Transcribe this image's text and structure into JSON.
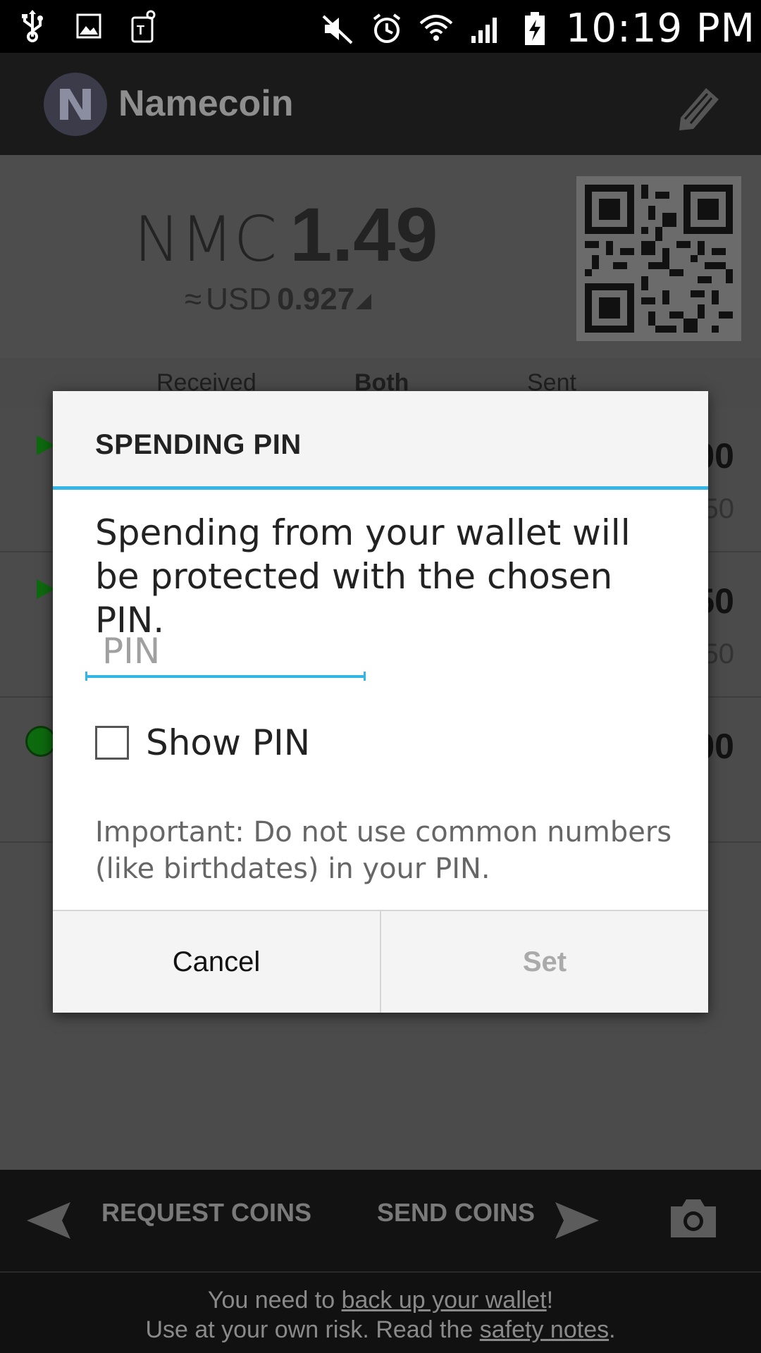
{
  "status_bar": {
    "time": "10:19 PM",
    "icons": [
      "usb-icon",
      "image-icon",
      "tmobile-icon",
      "mute-icon",
      "alarm-icon",
      "wifi-icon",
      "signal-icon",
      "battery-charging-icon"
    ]
  },
  "app_bar": {
    "title": "Namecoin",
    "logo_icon": "namecoin-logo-icon",
    "action_icon": "edit-icon"
  },
  "balance": {
    "unit": "NMC",
    "value": "1.49",
    "approx_symbol": "≈",
    "local_currency": "USD",
    "local_value": "0.927"
  },
  "tabs": [
    {
      "label": "Received"
    },
    {
      "label": "Both"
    },
    {
      "label": "Sent"
    }
  ],
  "transactions": [
    {
      "amount": "00",
      "sub": "50"
    },
    {
      "amount": "50",
      "sub": "50"
    },
    {
      "amount": "00",
      "sub": ""
    }
  ],
  "bottom_bar": {
    "request_label": "REQUEST COINS",
    "send_label": "SEND COINS"
  },
  "footer": {
    "line1_prefix": "You need to ",
    "line1_link": "back up your wallet",
    "line1_suffix": "!",
    "line2_prefix": "Use at your own risk. Read the ",
    "line2_link": "safety notes",
    "line2_suffix": "."
  },
  "dialog": {
    "title": "SPENDING PIN",
    "message": "Spending from your wallet will be protected with the chosen PIN.",
    "pin_placeholder": "PIN",
    "pin_value": "",
    "show_pin_label": "Show PIN",
    "show_pin_checked": false,
    "note": "Important: Do not use common numbers (like birthdates) in your PIN.",
    "cancel_label": "Cancel",
    "set_label": "Set"
  },
  "colors": {
    "accent": "#33b5e5",
    "dim_overlay": "#4b4b4b"
  }
}
